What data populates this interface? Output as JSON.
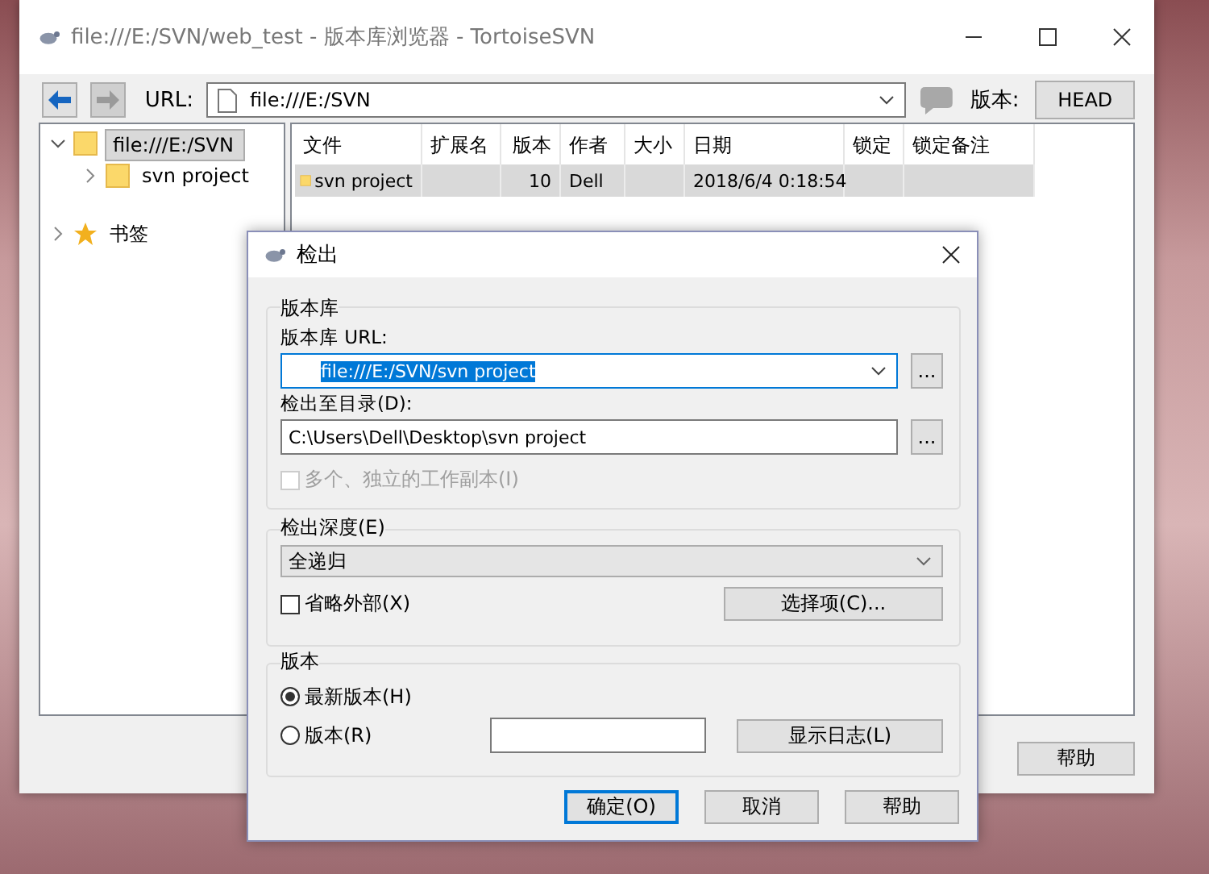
{
  "browser_window": {
    "title": "file:///E:/SVN/web_test - 版本库浏览器 - TortoiseSVN",
    "url_label": "URL:",
    "url": "file:///E:/SVN",
    "revision_label": "版本:",
    "revision_button": "HEAD",
    "tree": [
      {
        "kind": "folder",
        "label": "file:///E:/SVN",
        "expanded": true,
        "selected": true,
        "children": [
          {
            "kind": "folder",
            "label": "svn project",
            "expanded": false,
            "selected": false
          }
        ]
      },
      {
        "kind": "bookmarks",
        "label": "书签",
        "expanded": false,
        "selected": false
      }
    ],
    "columns": [
      "文件",
      "扩展名",
      "版本",
      "作者",
      "大小",
      "日期",
      "锁定",
      "锁定备注"
    ],
    "rows": [
      {
        "selected": true,
        "cells": [
          "svn project",
          "",
          "10",
          "Dell",
          "",
          "2018/6/4 0:18:54",
          "",
          ""
        ]
      }
    ],
    "buttons": [
      "帮助"
    ]
  },
  "dialog": {
    "title": "检出",
    "repository": {
      "legend": "版本库",
      "url_label": "版本库 URL:",
      "url": "file:///E:/SVN/svn project",
      "browse": "...",
      "dir_label": "检出至目录(D):",
      "dir": "C:\\Users\\Dell\\Desktop\\svn project",
      "dir_browse": "...",
      "multi_checkbox": {
        "label": "多个、独立的工作副本(I)",
        "checked": false,
        "disabled": true
      }
    },
    "depth": {
      "legend": "检出深度(E)",
      "value": "全递归",
      "omit_checkbox": {
        "label": "省略外部(X)",
        "checked": false,
        "disabled": false
      },
      "items_button": "选择项(C)..."
    },
    "revision": {
      "legend": "版本",
      "radios": [
        {
          "label": "最新版本(H)",
          "selected": true
        },
        {
          "label": "版本(R)",
          "selected": false
        }
      ],
      "show_log": "显示日志(L)"
    },
    "buttons": [
      {
        "label": "确定(O)",
        "default": true
      },
      {
        "label": "取消",
        "default": false
      },
      {
        "label": "帮助",
        "default": false
      }
    ]
  }
}
